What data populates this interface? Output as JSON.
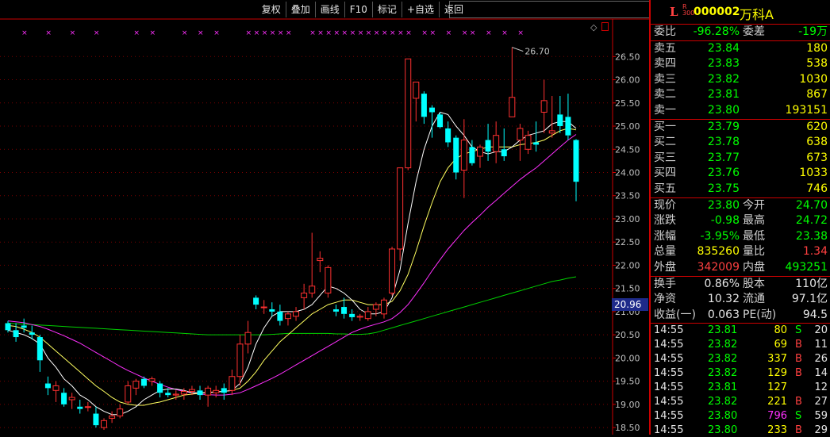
{
  "toolbar": [
    "复权",
    "叠加",
    "画线",
    "F10",
    "标记",
    "+自选",
    "返回"
  ],
  "header": {
    "market": "L",
    "badge_top": "R",
    "badge_bot": "300",
    "code": "000002",
    "name": "万科A"
  },
  "current_price_tag": "20.96",
  "quote": {
    "weibi_label": "委比",
    "weibi": "-96.28%",
    "weicha_label": "委差",
    "weicha": "-19万",
    "asks": [
      {
        "label": "卖五",
        "price": "23.84",
        "vol": "180"
      },
      {
        "label": "卖四",
        "price": "23.83",
        "vol": "538"
      },
      {
        "label": "卖三",
        "price": "23.82",
        "vol": "1030"
      },
      {
        "label": "卖二",
        "price": "23.81",
        "vol": "867"
      },
      {
        "label": "卖一",
        "price": "23.80",
        "vol": "193151"
      }
    ],
    "bids": [
      {
        "label": "买一",
        "price": "23.79",
        "vol": "620"
      },
      {
        "label": "买二",
        "price": "23.78",
        "vol": "638"
      },
      {
        "label": "买三",
        "price": "23.77",
        "vol": "673"
      },
      {
        "label": "买四",
        "price": "23.76",
        "vol": "1033"
      },
      {
        "label": "买五",
        "price": "23.75",
        "vol": "746"
      }
    ],
    "stats": [
      {
        "l1": "现价",
        "v1": "23.80",
        "c1": "g",
        "l2": "今开",
        "v2": "24.70",
        "c2": "g"
      },
      {
        "l1": "涨跌",
        "v1": "-0.98",
        "c1": "g",
        "l2": "最高",
        "v2": "24.72",
        "c2": "g"
      },
      {
        "l1": "涨幅",
        "v1": "-3.95%",
        "c1": "g",
        "l2": "最低",
        "v2": "23.38",
        "c2": "g"
      },
      {
        "l1": "总量",
        "v1": "835260",
        "c1": "y",
        "l2": "量比",
        "v2": "1.34",
        "c2": "r"
      },
      {
        "l1": "外盘",
        "v1": "342009",
        "c1": "r",
        "l2": "内盘",
        "v2": "493251",
        "c2": "g"
      }
    ],
    "fund": [
      {
        "l1": "换手",
        "v1": "0.86%",
        "l2": "股本",
        "v2": "110亿"
      },
      {
        "l1": "净资",
        "v1": "10.32",
        "l2": "流通",
        "v2": "97.1亿"
      },
      {
        "l1": "收益(一)",
        "v1": "0.063",
        "l2": "PE(动)",
        "v2": "94.5"
      }
    ]
  },
  "ticks": [
    {
      "time": "14:55",
      "price": "23.81",
      "vol": "80",
      "vc": "y",
      "bs": "S",
      "bc": "g",
      "cnt": "20"
    },
    {
      "time": "14:55",
      "price": "23.82",
      "vol": "69",
      "vc": "y",
      "bs": "B",
      "bc": "r",
      "cnt": "11"
    },
    {
      "time": "14:55",
      "price": "23.82",
      "vol": "337",
      "vc": "y",
      "bs": "B",
      "bc": "r",
      "cnt": "26"
    },
    {
      "time": "14:55",
      "price": "23.82",
      "vol": "129",
      "vc": "y",
      "bs": "B",
      "bc": "r",
      "cnt": "14"
    },
    {
      "time": "14:55",
      "price": "23.81",
      "vol": "127",
      "vc": "y",
      "bs": "",
      "bc": "g",
      "cnt": "12"
    },
    {
      "time": "14:55",
      "price": "23.82",
      "vol": "221",
      "vc": "y",
      "bs": "B",
      "bc": "r",
      "cnt": "27"
    },
    {
      "time": "14:55",
      "price": "23.80",
      "vol": "796",
      "vc": "m",
      "bs": "S",
      "bc": "g",
      "cnt": "59"
    },
    {
      "time": "14:55",
      "price": "23.80",
      "vol": "233",
      "vc": "y",
      "bs": "B",
      "bc": "r",
      "cnt": "29"
    }
  ],
  "chart_data": {
    "type": "candlestick",
    "y_ticks": [
      "26.50",
      "26.00",
      "25.50",
      "25.00",
      "24.50",
      "24.00",
      "23.50",
      "23.00",
      "22.50",
      "22.00",
      "21.50",
      "21.00",
      "20.50",
      "20.00",
      "19.50",
      "19.00",
      "18.50"
    ],
    "ylim": [
      18.45,
      26.95
    ],
    "max_annotation": "26.70",
    "candles": [
      [
        20.75,
        20.8,
        20.55,
        20.6
      ],
      [
        20.6,
        20.75,
        20.35,
        20.45
      ],
      [
        20.7,
        20.85,
        20.55,
        20.65
      ],
      [
        20.55,
        20.7,
        20.4,
        20.5
      ],
      [
        20.45,
        20.5,
        19.7,
        19.95
      ],
      [
        19.45,
        19.6,
        19.2,
        19.35
      ],
      [
        19.3,
        19.5,
        19.05,
        19.4
      ],
      [
        19.25,
        19.35,
        18.95,
        19.0
      ],
      [
        19.1,
        19.25,
        18.9,
        19.15
      ],
      [
        18.95,
        19.1,
        18.8,
        18.9
      ],
      [
        18.95,
        19.05,
        18.85,
        18.95
      ],
      [
        18.8,
        18.95,
        18.5,
        18.55
      ],
      [
        18.5,
        18.7,
        18.45,
        18.65
      ],
      [
        18.7,
        18.85,
        18.6,
        18.75
      ],
      [
        18.75,
        19.0,
        18.7,
        18.9
      ],
      [
        19.05,
        19.5,
        19.0,
        19.4
      ],
      [
        19.35,
        19.55,
        19.2,
        19.5
      ],
      [
        19.55,
        19.6,
        19.35,
        19.4
      ],
      [
        19.5,
        19.6,
        19.4,
        19.55
      ],
      [
        19.45,
        19.5,
        19.15,
        19.25
      ],
      [
        19.25,
        19.35,
        19.15,
        19.2
      ],
      [
        19.2,
        19.3,
        19.1,
        19.22
      ],
      [
        19.22,
        19.35,
        19.1,
        19.28
      ],
      [
        19.28,
        19.4,
        19.2,
        19.32
      ],
      [
        19.3,
        19.4,
        19.1,
        19.2
      ],
      [
        19.2,
        19.4,
        18.95,
        19.35
      ],
      [
        19.25,
        19.4,
        19.15,
        19.3
      ],
      [
        19.35,
        19.45,
        19.1,
        19.25
      ],
      [
        19.3,
        19.75,
        19.2,
        19.6
      ],
      [
        19.6,
        20.5,
        19.4,
        20.3
      ],
      [
        20.3,
        20.8,
        20.1,
        20.55
      ],
      [
        21.3,
        21.35,
        21.05,
        21.15
      ],
      [
        21.1,
        21.25,
        20.95,
        21.1
      ],
      [
        21.05,
        21.2,
        20.9,
        21.0
      ],
      [
        21.0,
        21.15,
        20.7,
        20.8
      ],
      [
        20.85,
        21.0,
        20.7,
        20.95
      ],
      [
        20.9,
        21.1,
        20.8,
        21.0
      ],
      [
        21.3,
        21.6,
        21.05,
        21.4
      ],
      [
        21.4,
        22.7,
        21.3,
        21.55
      ],
      [
        22.1,
        22.3,
        21.85,
        22.15
      ],
      [
        21.4,
        22.0,
        21.3,
        21.95
      ],
      [
        21.05,
        21.15,
        20.9,
        21.0
      ],
      [
        21.1,
        21.3,
        20.85,
        20.95
      ],
      [
        20.95,
        21.05,
        20.8,
        20.88
      ],
      [
        20.88,
        20.95,
        20.8,
        20.9
      ],
      [
        20.85,
        21.1,
        20.8,
        21.0
      ],
      [
        21.05,
        21.2,
        20.9,
        21.15
      ],
      [
        20.95,
        21.3,
        20.85,
        21.25
      ],
      [
        21.4,
        22.4,
        21.35,
        22.35
      ],
      [
        22.35,
        22.95,
        22.1,
        24.1
      ],
      [
        24.1,
        26.45,
        24.05,
        26.45
      ],
      [
        25.6,
        25.7,
        25.1,
        25.95
      ],
      [
        25.7,
        25.75,
        25.05,
        25.2
      ],
      [
        25.4,
        25.45,
        24.75,
        25.3
      ],
      [
        25.25,
        25.3,
        24.95,
        24.98
      ],
      [
        24.95,
        25.1,
        24.55,
        24.65
      ],
      [
        24.75,
        24.8,
        23.85,
        24.0
      ],
      [
        24.05,
        25.15,
        23.45,
        24.7
      ],
      [
        24.55,
        24.7,
        24.15,
        24.2
      ],
      [
        24.35,
        24.6,
        24.1,
        24.55
      ],
      [
        24.7,
        25.05,
        24.25,
        24.45
      ],
      [
        24.45,
        25.1,
        24.2,
        24.8
      ],
      [
        24.5,
        24.95,
        24.25,
        24.35
      ],
      [
        25.2,
        26.7,
        25.2,
        25.62
      ],
      [
        24.7,
        25.05,
        24.25,
        24.95
      ],
      [
        24.5,
        24.9,
        24.4,
        24.8
      ],
      [
        24.65,
        25.1,
        24.45,
        24.6
      ],
      [
        25.3,
        26.0,
        24.85,
        25.55
      ],
      [
        24.85,
        25.65,
        24.75,
        24.9
      ],
      [
        25.25,
        25.65,
        24.85,
        25.0
      ],
      [
        25.2,
        25.7,
        24.7,
        24.8
      ],
      [
        24.7,
        24.72,
        23.38,
        23.8
      ]
    ],
    "ma5": [
      20.6,
      20.55,
      20.5,
      20.42,
      20.3,
      20.0,
      19.8,
      19.55,
      19.4,
      19.2,
      19.1,
      18.95,
      18.85,
      18.78,
      18.78,
      18.85,
      18.95,
      19.1,
      19.2,
      19.3,
      19.33,
      19.33,
      19.3,
      19.25,
      19.25,
      19.25,
      19.27,
      19.28,
      19.3,
      19.45,
      19.8,
      20.3,
      20.65,
      20.9,
      21.0,
      21.0,
      21.0,
      21.05,
      21.15,
      21.35,
      21.55,
      21.5,
      21.4,
      21.25,
      21.05,
      20.95,
      20.95,
      21.0,
      21.3,
      21.9,
      22.9,
      23.8,
      24.5,
      25.0,
      25.3,
      25.25,
      25.0,
      24.8,
      24.55,
      24.45,
      24.4,
      24.45,
      24.45,
      24.55,
      24.7,
      24.8,
      24.85,
      24.9,
      25.05,
      25.1,
      25.1,
      24.95
    ],
    "ma10": [
      20.7,
      20.68,
      20.62,
      20.55,
      20.45,
      20.3,
      20.15,
      20.0,
      19.85,
      19.7,
      19.55,
      19.4,
      19.28,
      19.15,
      19.05,
      19.0,
      18.98,
      18.98,
      19.02,
      19.05,
      19.1,
      19.15,
      19.2,
      19.22,
      19.24,
      19.26,
      19.27,
      19.28,
      19.3,
      19.35,
      19.5,
      19.7,
      19.95,
      20.15,
      20.35,
      20.5,
      20.65,
      20.8,
      20.95,
      21.05,
      21.15,
      21.2,
      21.25,
      21.25,
      21.2,
      21.15,
      21.15,
      21.15,
      21.22,
      21.45,
      21.8,
      22.3,
      22.85,
      23.35,
      23.8,
      24.1,
      24.3,
      24.4,
      24.45,
      24.5,
      24.55,
      24.55,
      24.55,
      24.55,
      24.6,
      24.62,
      24.65,
      24.7,
      24.8,
      24.9,
      24.95,
      24.92
    ],
    "ma20": [
      20.8,
      20.78,
      20.76,
      20.72,
      20.68,
      20.62,
      20.55,
      20.48,
      20.4,
      20.32,
      20.22,
      20.12,
      20.02,
      19.92,
      19.82,
      19.73,
      19.65,
      19.57,
      19.5,
      19.43,
      19.37,
      19.32,
      19.28,
      19.25,
      19.22,
      19.21,
      19.2,
      19.2,
      19.22,
      19.25,
      19.32,
      19.4,
      19.48,
      19.56,
      19.65,
      19.75,
      19.85,
      19.95,
      20.05,
      20.15,
      20.25,
      20.35,
      20.45,
      20.55,
      20.62,
      20.68,
      20.73,
      20.78,
      20.85,
      20.98,
      21.15,
      21.38,
      21.62,
      21.88,
      22.12,
      22.35,
      22.55,
      22.75,
      22.92,
      23.08,
      23.25,
      23.4,
      23.55,
      23.7,
      23.85,
      23.98,
      24.1,
      24.25,
      24.4,
      24.55,
      24.7,
      24.82
    ],
    "ma60": [
      20.75,
      20.74,
      20.73,
      20.72,
      20.71,
      20.7,
      20.69,
      20.68,
      20.67,
      20.66,
      20.65,
      20.64,
      20.63,
      20.62,
      20.61,
      20.6,
      20.59,
      20.58,
      20.57,
      20.56,
      20.55,
      20.54,
      20.53,
      20.52,
      20.51,
      20.5,
      20.5,
      20.5,
      20.5,
      20.5,
      20.5,
      20.5,
      20.5,
      20.51,
      20.52,
      20.53,
      20.53,
      20.53,
      20.53,
      20.53,
      20.53,
      20.52,
      20.52,
      20.51,
      20.51,
      20.52,
      20.55,
      20.6,
      20.65,
      20.7,
      20.75,
      20.8,
      20.85,
      20.9,
      20.95,
      21.0,
      21.05,
      21.1,
      21.15,
      21.2,
      21.25,
      21.3,
      21.35,
      21.4,
      21.45,
      21.5,
      21.55,
      21.6,
      21.65,
      21.68,
      21.72,
      21.75
    ],
    "markers": [
      2,
      5,
      8,
      11,
      16,
      18,
      22,
      24,
      26,
      30,
      31,
      32,
      33,
      34,
      35,
      38,
      39,
      40,
      41,
      42,
      43,
      44,
      45,
      46,
      47,
      48,
      49,
      50,
      52,
      53,
      55,
      57,
      58,
      60,
      62,
      64
    ]
  }
}
